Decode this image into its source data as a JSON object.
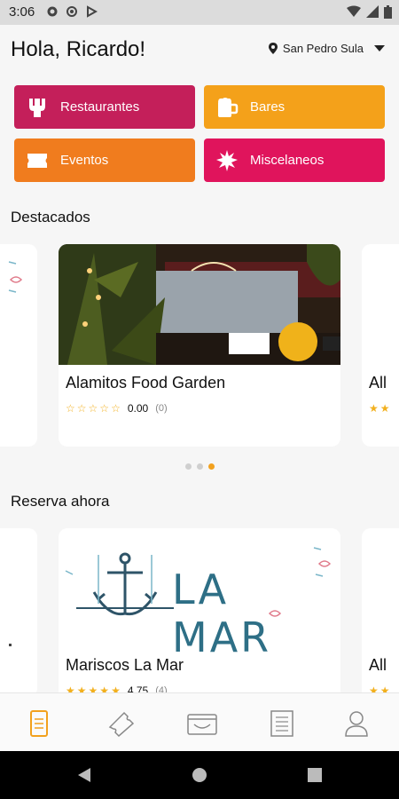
{
  "status_bar": {
    "time": "3:06"
  },
  "header": {
    "greeting": "Hola, Ricardo!",
    "location": "San Pedro Sula"
  },
  "categories": [
    {
      "label": "Restaurantes",
      "icon": "fork-icon",
      "color": "#c41f5a"
    },
    {
      "label": "Bares",
      "icon": "beer-mug-icon",
      "color": "#f4a11a"
    },
    {
      "label": "Eventos",
      "icon": "ticket-icon",
      "color": "#f07c1e"
    },
    {
      "label": "Miscelaneos",
      "icon": "burst-icon",
      "color": "#e0145c"
    }
  ],
  "featured": {
    "title": "Destacados",
    "cards": [
      {
        "name": "Alamitos Food Garden",
        "score": "0.00",
        "count": "(0)",
        "rating": 0
      },
      {
        "name": "All",
        "partial": true
      }
    ],
    "pager": {
      "total": 3,
      "active": 2
    }
  },
  "reserve": {
    "title": "Reserva ahora",
    "cards": [
      {
        "name": "Mariscos La Mar",
        "logo_text": "LA MAR",
        "score": "4.75",
        "count": "(4)",
        "rating": 4.75
      },
      {
        "name": "All",
        "partial": true
      }
    ]
  },
  "bottom_nav": {
    "items": [
      {
        "icon": "menu-list-icon",
        "active": true
      },
      {
        "icon": "ticket-icon",
        "active": false
      },
      {
        "icon": "wallet-icon",
        "active": false
      },
      {
        "icon": "receipt-icon",
        "active": false
      },
      {
        "icon": "user-icon",
        "active": false
      }
    ],
    "active_color": "#f2a11e"
  },
  "colors": {
    "accent": "#f2a11e",
    "star": "#f2b01e"
  }
}
